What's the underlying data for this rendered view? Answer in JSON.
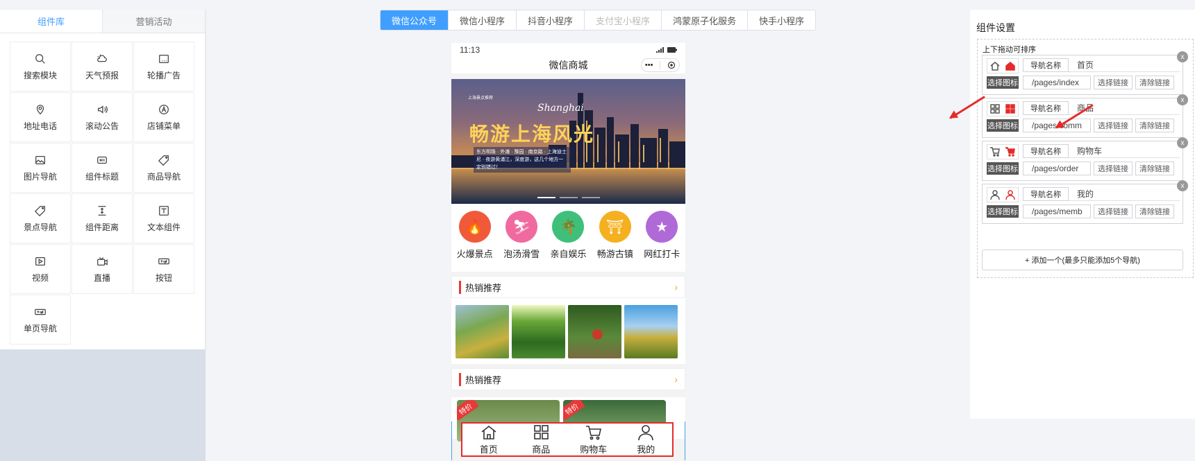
{
  "left_panel": {
    "tabs": [
      {
        "label": "组件库",
        "active": true
      },
      {
        "label": "营销活动",
        "active": false
      }
    ],
    "components": [
      {
        "label": "搜索模块",
        "icon": "search-icon"
      },
      {
        "label": "天气预报",
        "icon": "weather-icon"
      },
      {
        "label": "轮播广告",
        "icon": "carousel-icon"
      },
      {
        "label": "地址电话",
        "icon": "location-icon"
      },
      {
        "label": "滚动公告",
        "icon": "speaker-icon"
      },
      {
        "label": "店铺菜单",
        "icon": "store-icon"
      },
      {
        "label": "图片导航",
        "icon": "image-icon"
      },
      {
        "label": "组件标题",
        "icon": "heading-icon"
      },
      {
        "label": "商品导航",
        "icon": "tag-icon"
      },
      {
        "label": "景点导航",
        "icon": "tag-icon"
      },
      {
        "label": "组件距离",
        "icon": "spacing-icon"
      },
      {
        "label": "文本组件",
        "icon": "text-icon"
      },
      {
        "label": "视频",
        "icon": "video-icon"
      },
      {
        "label": "直播",
        "icon": "live-icon"
      },
      {
        "label": "按钮",
        "icon": "button-icon"
      },
      {
        "label": "单页导航",
        "icon": "button-icon"
      }
    ]
  },
  "platform_tabs": [
    {
      "label": "微信公众号",
      "state": "active"
    },
    {
      "label": "微信小程序",
      "state": "normal"
    },
    {
      "label": "抖音小程序",
      "state": "normal"
    },
    {
      "label": "支付宝小程序",
      "state": "disabled"
    },
    {
      "label": "鸿蒙原子化服务",
      "state": "normal"
    },
    {
      "label": "快手小程序",
      "state": "normal"
    }
  ],
  "phone": {
    "time": "11:13",
    "title": "微信商城",
    "capsule_more": "•••",
    "banner": {
      "small_text": "上海景点推荐",
      "script_text": "Shanghai",
      "headline": "畅游上海风光",
      "desc": "东方明珠 · 外滩 · 豫园 · 南京路 · 上海迪士尼 · 夜游黄浦江，深度游，这几个地方一定别错过！"
    },
    "categories": [
      {
        "label": "火爆景点",
        "color": "#f05a3a",
        "glyph": "🔥"
      },
      {
        "label": "泡汤滑雪",
        "color": "#f06aa0",
        "glyph": "⛷"
      },
      {
        "label": "亲自娱乐",
        "color": "#3ec07a",
        "glyph": "🌴"
      },
      {
        "label": "畅游古镇",
        "color": "#f5b020",
        "glyph": "⛩"
      },
      {
        "label": "网红打卡",
        "color": "#b06ad8",
        "glyph": "★"
      }
    ],
    "section1": {
      "title": "热销推荐",
      "arrow": "›"
    },
    "section2": {
      "title": "热销推荐",
      "arrow": "›"
    },
    "product_tag": "特价",
    "tabbar": [
      {
        "label": "首页",
        "icon": "home-icon"
      },
      {
        "label": "商品",
        "icon": "grid-icon"
      },
      {
        "label": "购物车",
        "icon": "cart-icon"
      },
      {
        "label": "我的",
        "icon": "user-icon"
      }
    ]
  },
  "settings": {
    "title": "组件设置",
    "hint": "上下拖动可排序",
    "select_icon_label": "选择图标",
    "name_label": "导航名称",
    "select_link_label": "选择链接",
    "clear_link_label": "清除链接",
    "close_label": "x",
    "items": [
      {
        "name": "首页",
        "path": "/pages/index",
        "icon": "home-icon"
      },
      {
        "name": "商品",
        "path": "/pages/comm",
        "icon": "grid-icon"
      },
      {
        "name": "购物车",
        "path": "/pages/order",
        "icon": "cart-icon"
      },
      {
        "name": "我的",
        "path": "/pages/memb",
        "icon": "user-icon"
      }
    ],
    "add_button": "+ 添加一个(最多只能添加5个导航)"
  },
  "colors": {
    "accent": "#409eff",
    "highlight": "#e52a2a"
  }
}
